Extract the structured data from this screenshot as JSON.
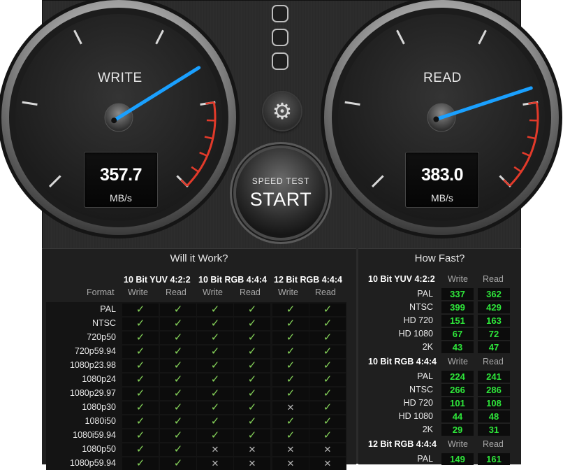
{
  "gauges": {
    "write": {
      "label": "WRITE",
      "value": "357.7",
      "unit": "MB/s",
      "reading": 357.7
    },
    "read": {
      "label": "READ",
      "value": "383.0",
      "unit": "MB/s",
      "reading": 383.0
    }
  },
  "start_button": {
    "top_label": "SPEED TEST",
    "label": "START"
  },
  "will_it_work": {
    "title": "Will it Work?",
    "format_label": "Format",
    "groups": [
      "10 Bit YUV 4:2:2",
      "10 Bit RGB 4:4:4",
      "12 Bit RGB 4:4:4"
    ],
    "subheaders": [
      "Write",
      "Read"
    ],
    "rows": [
      {
        "format": "PAL",
        "marks": [
          "yes",
          "yes",
          "yes",
          "yes",
          "yes",
          "yes"
        ]
      },
      {
        "format": "NTSC",
        "marks": [
          "yes",
          "yes",
          "yes",
          "yes",
          "yes",
          "yes"
        ]
      },
      {
        "format": "720p50",
        "marks": [
          "yes",
          "yes",
          "yes",
          "yes",
          "yes",
          "yes"
        ]
      },
      {
        "format": "720p59.94",
        "marks": [
          "yes",
          "yes",
          "yes",
          "yes",
          "yes",
          "yes"
        ]
      },
      {
        "format": "1080p23.98",
        "marks": [
          "yes",
          "yes",
          "yes",
          "yes",
          "yes",
          "yes"
        ]
      },
      {
        "format": "1080p24",
        "marks": [
          "yes",
          "yes",
          "yes",
          "yes",
          "yes",
          "yes"
        ]
      },
      {
        "format": "1080p29.97",
        "marks": [
          "yes",
          "yes",
          "yes",
          "yes",
          "yes",
          "yes"
        ]
      },
      {
        "format": "1080p30",
        "marks": [
          "yes",
          "yes",
          "yes",
          "yes",
          "no",
          "yes"
        ]
      },
      {
        "format": "1080i50",
        "marks": [
          "yes",
          "yes",
          "yes",
          "yes",
          "yes",
          "yes"
        ]
      },
      {
        "format": "1080i59.94",
        "marks": [
          "yes",
          "yes",
          "yes",
          "yes",
          "yes",
          "yes"
        ]
      },
      {
        "format": "1080p50",
        "marks": [
          "yes",
          "yes",
          "no",
          "no",
          "no",
          "no"
        ]
      },
      {
        "format": "1080p59.94",
        "marks": [
          "yes",
          "yes",
          "no",
          "no",
          "no",
          "no"
        ]
      }
    ]
  },
  "how_fast": {
    "title": "How Fast?",
    "subheaders": [
      "Write",
      "Read"
    ],
    "groups": [
      {
        "name": "10 Bit YUV 4:2:2",
        "rows": [
          {
            "format": "PAL",
            "write": "337",
            "read": "362"
          },
          {
            "format": "NTSC",
            "write": "399",
            "read": "429"
          },
          {
            "format": "HD 720",
            "write": "151",
            "read": "163"
          },
          {
            "format": "HD 1080",
            "write": "67",
            "read": "72"
          },
          {
            "format": "2K",
            "write": "43",
            "read": "47"
          }
        ]
      },
      {
        "name": "10 Bit RGB 4:4:4",
        "rows": [
          {
            "format": "PAL",
            "write": "224",
            "read": "241"
          },
          {
            "format": "NTSC",
            "write": "266",
            "read": "286"
          },
          {
            "format": "HD 720",
            "write": "101",
            "read": "108"
          },
          {
            "format": "HD 1080",
            "write": "44",
            "read": "48"
          },
          {
            "format": "2K",
            "write": "29",
            "read": "31"
          }
        ]
      },
      {
        "name": "12 Bit RGB 4:4:4",
        "rows": [
          {
            "format": "PAL",
            "write": "149",
            "read": "161"
          }
        ]
      }
    ]
  },
  "colors": {
    "needle": "#1aa0ff",
    "check": "#86d45a",
    "fast_value": "#2ee63a",
    "redline": "#e23a2a"
  }
}
